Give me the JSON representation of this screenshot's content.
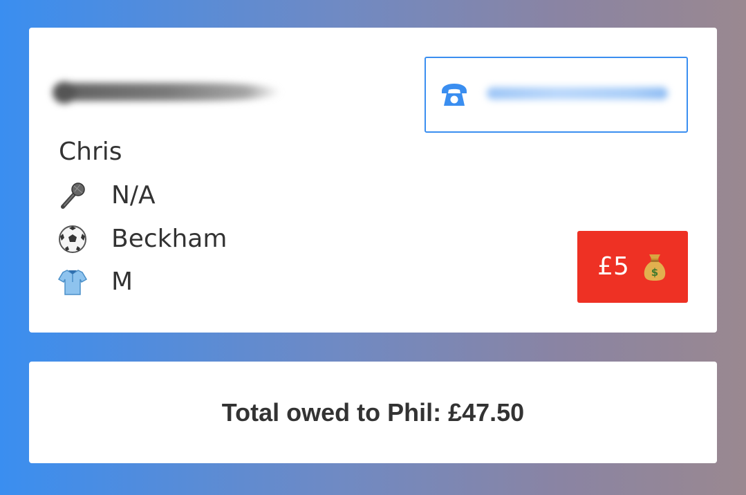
{
  "player": {
    "name": "Chris",
    "position": "N/A",
    "favourite_player": "Beckham",
    "shirt_size": "M",
    "icons": {
      "position": "microphone-icon",
      "favourite_player": "football-icon",
      "shirt_size": "shirt-icon",
      "phone": "telephone-icon",
      "payment": "money-bag-icon"
    }
  },
  "payment": {
    "amount_label": "£5",
    "color": "#ee3124"
  },
  "summary": {
    "total_text": "Total owed to Phil: £47.50"
  },
  "colors": {
    "accent": "#3a8ef0",
    "text": "#333333"
  }
}
